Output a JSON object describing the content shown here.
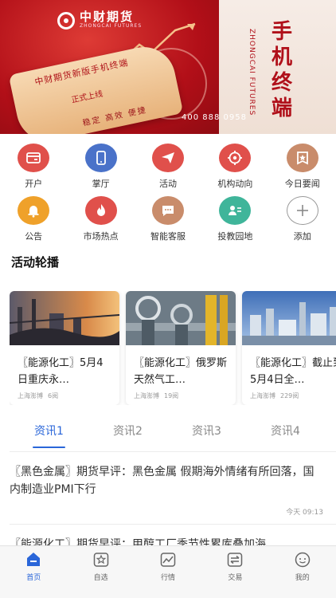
{
  "banner": {
    "logo_name": "中财期货",
    "logo_sub": "ZHONGCAI FUTURES",
    "scroll_line1": "中财期货新版手机终端",
    "scroll_line2": "正式上线",
    "scroll_line3": "稳定 高效 便捷",
    "phone": "400 888 0958",
    "hero_title": "手机终端",
    "hero_vertical": "ZHONGCAI FUTURES"
  },
  "grid": {
    "items": [
      {
        "label": "开户",
        "icon": "card-icon",
        "color": "#e0504b"
      },
      {
        "label": "掌厅",
        "icon": "phone-icon",
        "color": "#4a72c9"
      },
      {
        "label": "活动",
        "icon": "paper-plane-icon",
        "color": "#e0504b"
      },
      {
        "label": "机构动向",
        "icon": "target-icon",
        "color": "#e0504b"
      },
      {
        "label": "今日要闻",
        "icon": "star-bookmark-icon",
        "color": "#c98c6b"
      },
      {
        "label": "公告",
        "icon": "bell-icon",
        "color": "#efa12a"
      },
      {
        "label": "市场热点",
        "icon": "flame-icon",
        "color": "#e0504b"
      },
      {
        "label": "智能客服",
        "icon": "chat-icon",
        "color": "#c98c6b"
      },
      {
        "label": "投教园地",
        "icon": "person-list-icon",
        "color": "#3fb59a"
      },
      {
        "label": "添加",
        "icon": "plus-icon",
        "color": "#ffffff"
      }
    ]
  },
  "activity": {
    "title": "活动轮播",
    "cards": [
      {
        "title": "〖能源化工〗5月4日重庆永…",
        "source": "上海澎博",
        "count": "6阅"
      },
      {
        "title": "〖能源化工〗俄罗斯天然气工…",
        "source": "上海澎博",
        "count": "19阅"
      },
      {
        "title": "〖能源化工〗截止到5月4日全…",
        "source": "上海澎博",
        "count": "229阅"
      }
    ]
  },
  "tabs": [
    "资讯1",
    "资讯2",
    "资讯3",
    "资讯4"
  ],
  "news": [
    {
      "title": "〖黑色金属〗期货早评：黑色金属 假期海外情绪有所回落，国内制造业PMI下行",
      "time": "今天 09:13"
    },
    {
      "title": "〖能源化工〗期货早评：甲醇工厂季节性累库叠加海",
      "time": ""
    }
  ],
  "bottom_nav": [
    {
      "label": "首页",
      "icon": "home-icon"
    },
    {
      "label": "自选",
      "icon": "star-icon"
    },
    {
      "label": "行情",
      "icon": "chart-icon"
    },
    {
      "label": "交易",
      "icon": "exchange-icon"
    },
    {
      "label": "我的",
      "icon": "profile-icon"
    }
  ]
}
